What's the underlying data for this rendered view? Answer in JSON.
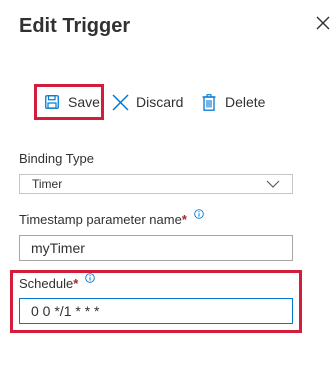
{
  "panel": {
    "title": "Edit Trigger"
  },
  "toolbar": {
    "save_label": "Save",
    "discard_label": "Discard",
    "delete_label": "Delete"
  },
  "icons": {
    "save": "save-icon",
    "discard": "close-icon",
    "delete": "trash-icon",
    "close": "close-icon",
    "info": "info-icon",
    "chevron": "chevron-down-icon"
  },
  "form": {
    "binding_type": {
      "label": "Binding Type",
      "value": "Timer"
    },
    "timestamp_param": {
      "label": "Timestamp parameter name",
      "required_mark": "*",
      "value": "myTimer"
    },
    "schedule": {
      "label": "Schedule",
      "required_mark": "*",
      "value": "0 0 */1 * * *"
    }
  },
  "colors": {
    "highlight": "#d21e3c",
    "accent": "#0078d4",
    "required": "#a4262c",
    "text": "#323130"
  }
}
